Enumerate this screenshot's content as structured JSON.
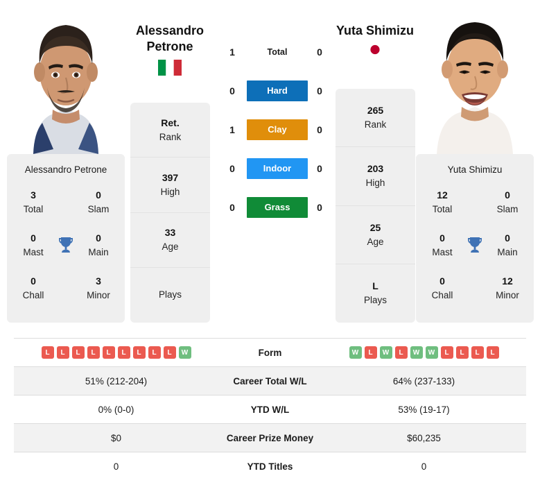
{
  "players": {
    "left": {
      "name_line1": "Alessandro",
      "name_line2": "Petrone",
      "full_name": "Alessandro Petrone",
      "country": "Italy",
      "flag_icon": "flag-italy",
      "photo_alt": "Alessandro Petrone headshot",
      "titles": {
        "total_value": "3",
        "total_label": "Total",
        "slam_value": "0",
        "slam_label": "Slam",
        "mast_value": "0",
        "mast_label": "Mast",
        "main_value": "0",
        "main_label": "Main",
        "chall_value": "0",
        "chall_label": "Chall",
        "minor_value": "3",
        "minor_label": "Minor"
      },
      "ranking": [
        {
          "value": "Ret.",
          "label": "Rank"
        },
        {
          "value": "397",
          "label": "High"
        },
        {
          "value": "33",
          "label": "Age"
        },
        {
          "value": "",
          "label": "Plays"
        }
      ],
      "form": [
        "L",
        "L",
        "L",
        "L",
        "L",
        "L",
        "L",
        "L",
        "L",
        "W"
      ],
      "career_total_wl": "51% (212-204)",
      "ytd_wl": "0% (0-0)",
      "career_prize_money": "$0",
      "ytd_titles": "0"
    },
    "right": {
      "name_line1": "Yuta Shimizu",
      "name_line2": "",
      "full_name": "Yuta Shimizu",
      "country": "Japan",
      "flag_icon": "flag-japan",
      "photo_alt": "Yuta Shimizu headshot",
      "titles": {
        "total_value": "12",
        "total_label": "Total",
        "slam_value": "0",
        "slam_label": "Slam",
        "mast_value": "0",
        "mast_label": "Mast",
        "main_value": "0",
        "main_label": "Main",
        "chall_value": "0",
        "chall_label": "Chall",
        "minor_value": "12",
        "minor_label": "Minor"
      },
      "ranking": [
        {
          "value": "265",
          "label": "Rank"
        },
        {
          "value": "203",
          "label": "High"
        },
        {
          "value": "25",
          "label": "Age"
        },
        {
          "value": "L",
          "label": "Plays"
        }
      ],
      "form": [
        "W",
        "L",
        "W",
        "L",
        "W",
        "W",
        "L",
        "L",
        "L",
        "L"
      ],
      "career_total_wl": "64% (237-133)",
      "ytd_wl": "53% (19-17)",
      "career_prize_money": "$60,235",
      "ytd_titles": "0"
    }
  },
  "head_to_head": [
    {
      "label": "Total",
      "left": "1",
      "right": "0",
      "style": "plain",
      "color": ""
    },
    {
      "label": "Hard",
      "left": "0",
      "right": "0",
      "style": "pill",
      "color": "#0d6fb8"
    },
    {
      "label": "Clay",
      "left": "1",
      "right": "0",
      "style": "pill",
      "color": "#e08e0b"
    },
    {
      "label": "Indoor",
      "left": "0",
      "right": "0",
      "style": "pill",
      "color": "#2196f3"
    },
    {
      "label": "Grass",
      "left": "0",
      "right": "0",
      "style": "pill",
      "color": "#108b37"
    }
  ],
  "comparison_rows": [
    {
      "label": "Form",
      "type": "form"
    },
    {
      "label": "Career Total W/L",
      "type": "text",
      "left": "51% (212-204)",
      "right": "64% (237-133)"
    },
    {
      "label": "YTD W/L",
      "type": "text",
      "left": "0% (0-0)",
      "right": "53% (19-17)"
    },
    {
      "label": "Career Prize Money",
      "type": "text",
      "left": "$0",
      "right": "$60,235"
    },
    {
      "label": "YTD Titles",
      "type": "text",
      "left": "0",
      "right": "0"
    }
  ],
  "colors": {
    "win_badge": "#6fbe7f",
    "loss_badge": "#eb5a50",
    "trophy": "#3f72b5",
    "card_bg": "#efefef",
    "row_alt_bg": "#f2f2f2",
    "flag_italy_green": "#009246",
    "flag_italy_red": "#ce2b37",
    "flag_japan_red": "#bc002d"
  }
}
